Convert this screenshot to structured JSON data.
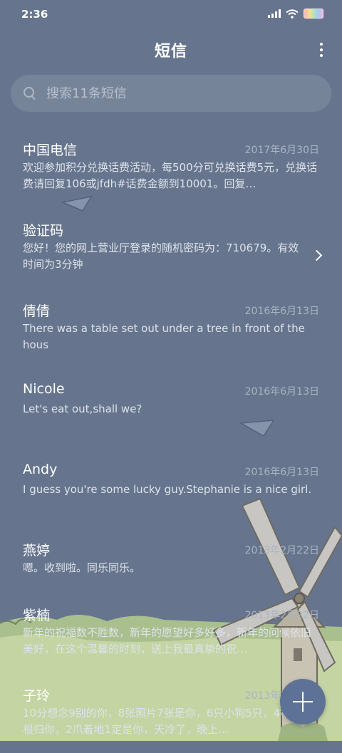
{
  "status": {
    "time": "2:36"
  },
  "header": {
    "title": "短信"
  },
  "search": {
    "placeholder": "搜索11条短信"
  },
  "messages": [
    {
      "name": "中国电信",
      "date": "2017年6月30日",
      "preview": "欢迎参加积分兑换话费活动，每500分可兑换话费5元，兑换话费请回复106或jfdh#话费金额到10001。回复…"
    },
    {
      "name": "验证码",
      "date": "",
      "preview": "您好！您的网上营业厅登录的随机密码为：710679。有效时间为3分钟"
    },
    {
      "name": "倩倩",
      "date": "2016年6月13日",
      "preview": "There was a table set out under a tree in front of the hous"
    },
    {
      "name": "Nicole",
      "date": "2016年6月13日",
      "preview": "Let's eat out,shall we?"
    },
    {
      "name": "Andy",
      "date": "2016年6月13日",
      "preview": "I guess you're some lucky guy.Stephanie is a nice girl."
    },
    {
      "name": "燕婷",
      "date": "2013年2月22日",
      "preview": "嗯。收到啦。同乐同乐。"
    },
    {
      "name": "紫楠",
      "date": "2013年2月22日",
      "preview": "新年的祝福数不胜数，新年的愿望好多好多，新年的问候依旧美好，在这个温馨的时刻，送上我最真挚的祝…"
    },
    {
      "name": "子玲",
      "date": "2013年2月22日",
      "preview": "10分想念9别的你，8张照片7张是你，6只小狗5只，4根骨头3根归你，2爪着地1定是你，天冷了，晚上…"
    }
  ],
  "icons": {
    "search": "search-icon",
    "more": "more-vert-icon",
    "compose": "plus-icon",
    "chevron": "chevron-right-icon"
  },
  "colors": {
    "background": "#66758d",
    "fab": "#5d7296"
  }
}
